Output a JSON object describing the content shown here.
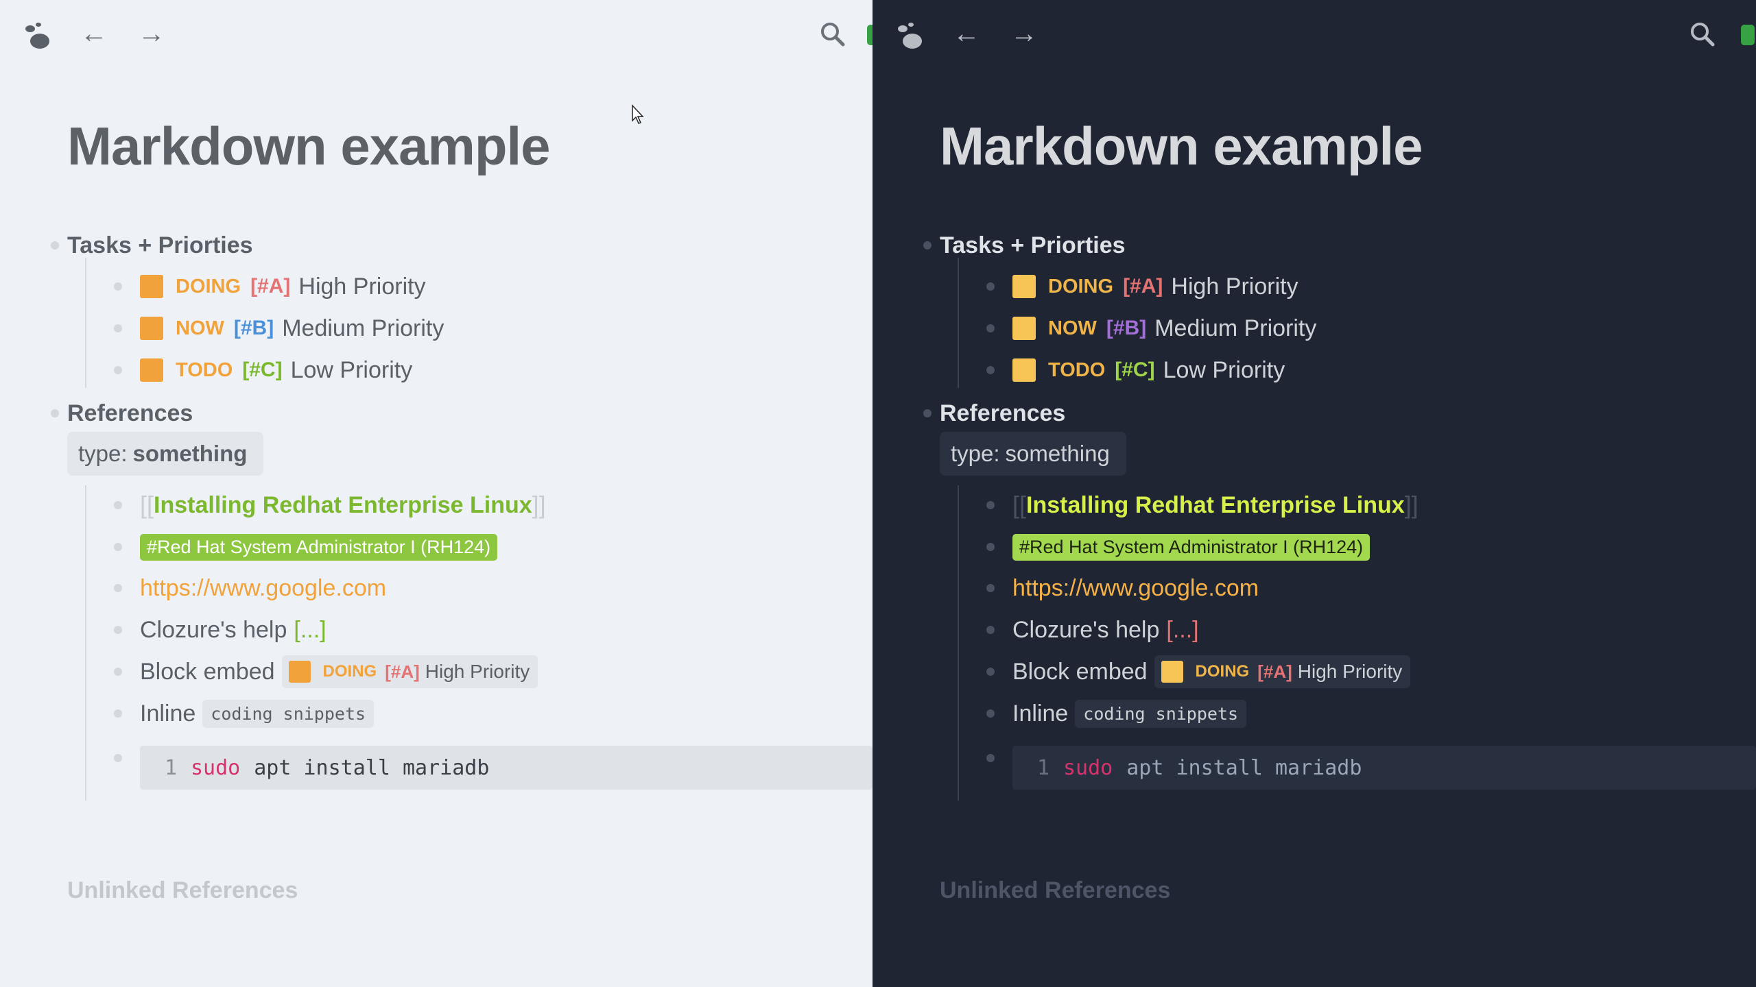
{
  "panes": {
    "light": {
      "nav": {
        "back": "←",
        "forward": "→"
      },
      "title": "Markdown example",
      "tasks_heading": "Tasks + Priorties",
      "tasks": [
        {
          "marker": "DOING",
          "priority": "[#A]",
          "label": "High Priority"
        },
        {
          "marker": "NOW",
          "priority": "[#B]",
          "label": "Medium Priority"
        },
        {
          "marker": "TODO",
          "priority": "[#C]",
          "label": "Low Priority"
        }
      ],
      "references_heading": "References",
      "property": {
        "key": "type:",
        "value": "something"
      },
      "page_link": {
        "open": "[[",
        "text": "Installing Redhat Enterprise Linux",
        "close": "]]"
      },
      "tag": "#Red Hat System Administrator I (RH124)",
      "url": "https://www.google.com",
      "clozure": {
        "text": "Clozure's help",
        "ellipsis": "[...]"
      },
      "block_embed": {
        "label": "Block embed",
        "marker": "DOING",
        "priority": "[#A]",
        "text": "High Priority"
      },
      "inline": {
        "label": "Inline",
        "code": "coding snippets"
      },
      "code_block": {
        "line_number": "1",
        "keyword": "sudo",
        "rest": "apt install mariadb"
      },
      "unlinked": "Unlinked References"
    },
    "dark": {
      "nav": {
        "back": "←",
        "forward": "→"
      },
      "title": "Markdown example",
      "tasks_heading": "Tasks + Priorties",
      "tasks": [
        {
          "marker": "DOING",
          "priority": "[#A]",
          "label": "High Priority"
        },
        {
          "marker": "NOW",
          "priority": "[#B]",
          "label": "Medium Priority"
        },
        {
          "marker": "TODO",
          "priority": "[#C]",
          "label": "Low Priority"
        }
      ],
      "references_heading": "References",
      "property": {
        "key": "type:",
        "value": "something"
      },
      "page_link": {
        "open": "[[",
        "text": "Installing Redhat Enterprise Linux",
        "close": "]]"
      },
      "tag": "#Red Hat System Administrator I (RH124)",
      "url": "https://www.google.com",
      "clozure": {
        "text": "Clozure's help",
        "ellipsis": "[...]"
      },
      "block_embed": {
        "label": "Block embed",
        "marker": "DOING",
        "priority": "[#A]",
        "text": "High Priority"
      },
      "inline": {
        "label": "Inline",
        "code": "coding snippets"
      },
      "code_block": {
        "line_number": "1",
        "keyword": "sudo",
        "rest": "apt install mariadb"
      },
      "unlinked": "Unlinked References"
    }
  },
  "icons": {
    "logo": "logseq-logo-icon",
    "search": "search-icon",
    "back": "arrow-left-icon",
    "forward": "arrow-right-icon"
  },
  "colors": {
    "light_bg": "#eef1f5",
    "dark_bg": "#1f2533",
    "todo_orange": "#f2a23a",
    "tag_green": "#8dc63f",
    "sync_green": "#37a244"
  }
}
